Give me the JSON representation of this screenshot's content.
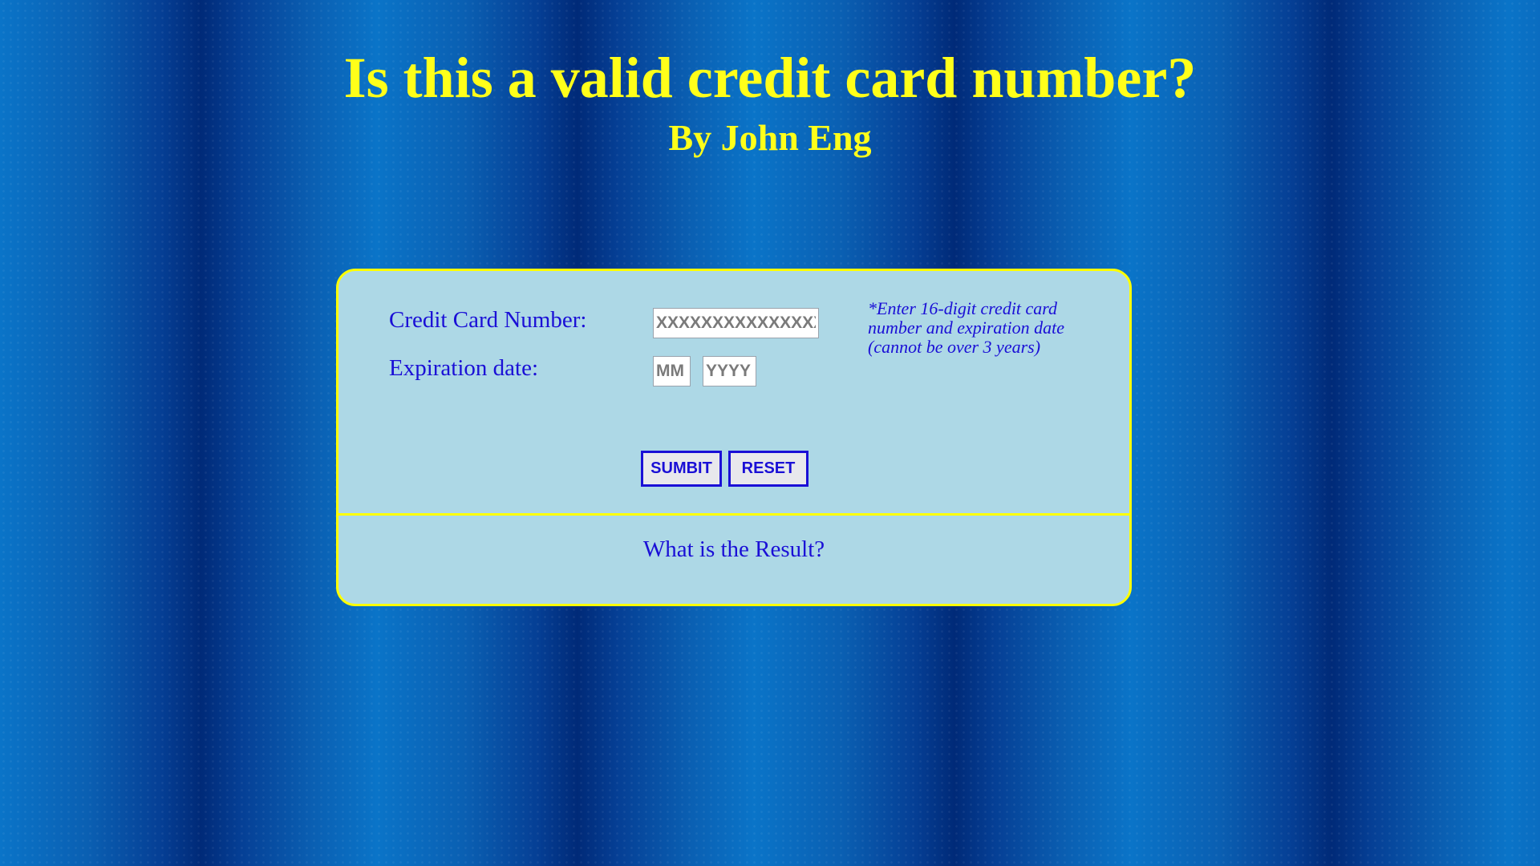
{
  "header": {
    "title": "Is this a valid credit card number?",
    "subtitle": "By John Eng"
  },
  "form": {
    "card_number_label": "Credit Card Number:",
    "card_number_placeholder": "XXXXXXXXXXXXXXXX",
    "card_number_value": "",
    "expiration_label": "Expiration date:",
    "month_placeholder": "MM",
    "month_value": "",
    "year_placeholder": "YYYY",
    "year_value": "",
    "hint": "*Enter 16-digit credit card number and expiration date (cannot be over 3 years)",
    "submit_label": "SUMBIT",
    "reset_label": "RESET"
  },
  "result": {
    "text": "What is the Result?"
  },
  "colors": {
    "heading": "#ffff1a",
    "card_background": "#add8e6",
    "card_border": "#ffff00",
    "form_text": "#1a0fd6",
    "background": "#0a3d8f"
  }
}
